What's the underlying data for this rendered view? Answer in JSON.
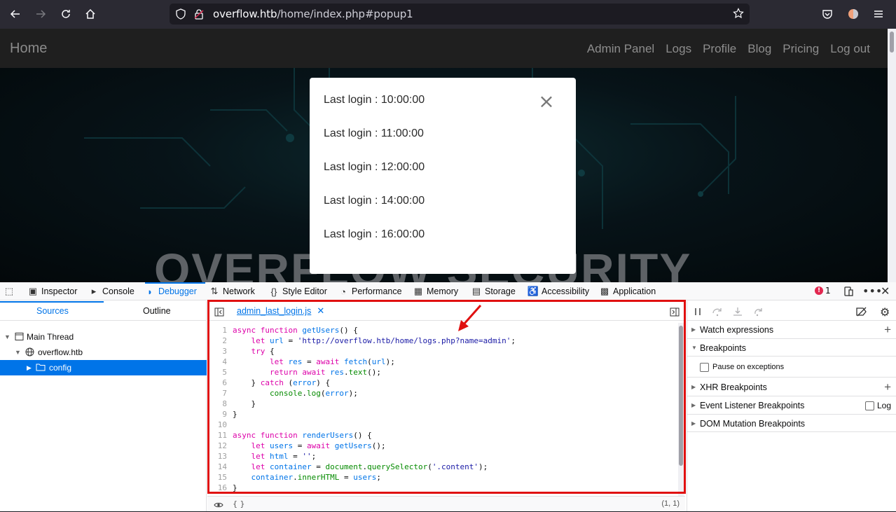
{
  "browser": {
    "url_domain": "overflow.htb",
    "url_path": "/home/index.php#popup1"
  },
  "site": {
    "brand": "Home",
    "nav": [
      "Admin Panel",
      "Logs",
      "Profile",
      "Blog",
      "Pricing",
      "Log out"
    ],
    "hero_title": "OVERFLOW SECURITY"
  },
  "popup": {
    "lines": [
      "Last login : 10:00:00",
      "Last login : 11:00:00",
      "Last login : 12:00:00",
      "Last login : 14:00:00",
      "Last login : 16:00:00"
    ],
    "close": "×"
  },
  "devtools": {
    "tabs": [
      "Inspector",
      "Console",
      "Debugger",
      "Network",
      "Style Editor",
      "Performance",
      "Memory",
      "Storage",
      "Accessibility",
      "Application"
    ],
    "error_count": "1",
    "left_tabs": [
      "Sources",
      "Outline"
    ],
    "tree": [
      "Main Thread",
      "overflow.htb",
      "config"
    ],
    "file_tab": "admin_last_login.js",
    "cursor_pos": "(1, 1)",
    "pretty_print": "{ }",
    "right_rows": [
      "Watch expressions",
      "Breakpoints",
      "Pause on exceptions",
      "XHR Breakpoints",
      "Event Listener Breakpoints",
      "DOM Mutation Breakpoints"
    ],
    "log_label": "Log"
  },
  "code_lines": [
    "1",
    "2",
    "3",
    "4",
    "5",
    "6",
    "7",
    "8",
    "9",
    "10",
    "11",
    "12",
    "13",
    "14",
    "15",
    "16"
  ]
}
